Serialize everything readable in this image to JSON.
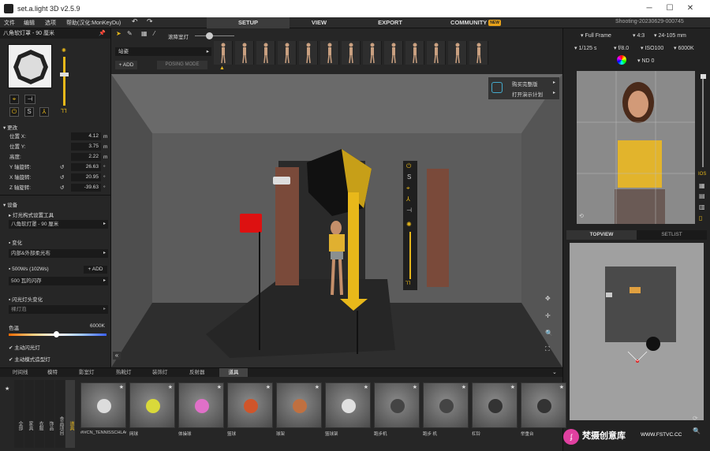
{
  "window": {
    "title": "set.a.light 3D v2.5.9",
    "file_name": "Shooting-20230629-000745"
  },
  "menu": [
    "文件",
    "编辑",
    "选项",
    "帮助(汉化:MonKeyDu)"
  ],
  "tabs": [
    {
      "label": "SETUP",
      "active": true
    },
    {
      "label": "VIEW",
      "active": false
    },
    {
      "label": "EXPORT",
      "active": false
    },
    {
      "label": "COMMUNITY",
      "badge": "NEW",
      "active": false
    }
  ],
  "toolbar": {
    "snap_label": "滚降室灯"
  },
  "left_panel": {
    "title": "八角软灯罩 - 90 厘米",
    "change_section": "更改",
    "fields": [
      {
        "label": "位置 X:",
        "value": "4.12",
        "unit": "m",
        "rotate": false
      },
      {
        "label": "位置 Y:",
        "value": "3.75",
        "unit": "m",
        "rotate": false
      },
      {
        "label": "高度:",
        "value": "2.22",
        "unit": "m",
        "rotate": false
      },
      {
        "label": "Y 轴旋转:",
        "value": "26.63",
        "unit": "°",
        "rotate": true
      },
      {
        "label": "X 轴旋转:",
        "value": "20.95",
        "unit": "°",
        "rotate": true
      },
      {
        "label": "Z 轴旋转:",
        "value": "-39.63",
        "unit": "°",
        "rotate": true
      }
    ],
    "device_section": "设备",
    "shaper_label": "灯光构式设置工具",
    "shaper_value": "八角软灯罩 - 90 厘米",
    "change2_label": "变化",
    "change2_value": "内部&外部柔光布",
    "power_label": "500Ws (102Ws)",
    "add_label": "ADD",
    "flash_value": "500 瓦的闪存",
    "head_label": "闪光灯头变化",
    "head_value": "裸灯泡",
    "color_temp_label": "色温",
    "color_temp_value": "6000K",
    "check1": "主动闪光灯",
    "check2": "主动模式造型灯"
  },
  "pose_bar": {
    "category": "站姿",
    "add_label": "ADD",
    "posing_mode": "POSING MODE"
  },
  "viewport_menu": {
    "item1": "购买完整版",
    "item2": "打开演示计划"
  },
  "camera": {
    "frame": "Full Frame",
    "ratio": "4:3",
    "lens": "24-105 mm",
    "shutter": "1/125 s",
    "aperture": "f/8.0",
    "iso": "ISO100",
    "wb": "6000K",
    "nd": "ND 0",
    "ios_label": "IOS"
  },
  "right_tabs": {
    "topview": "TOPVIEW",
    "setlist": "SETLIST"
  },
  "bottom": {
    "categories": [
      "时间线",
      "模特",
      "影室灯",
      "热靴灯",
      "装饰灯",
      "反射器",
      "道具"
    ],
    "side_tabs": [
      "全部",
      "家具",
      "衣服",
      "饰品",
      "食品项目",
      "道具"
    ],
    "items": [
      {
        "label": "#I#CN_TENNISSCHLAGER_01#I#",
        "color": "#dcdcdc"
      },
      {
        "label": "网球",
        "color": "#d9d93a"
      },
      {
        "label": "体操球",
        "color": "#e070c8"
      },
      {
        "label": "篮球",
        "color": "#d0552a"
      },
      {
        "label": "球架",
        "color": "#c07040"
      },
      {
        "label": "篮球架",
        "color": "#e0e0e0"
      },
      {
        "label": "跑步机",
        "color": "#444444"
      },
      {
        "label": "跑步 机",
        "color": "#444444"
      },
      {
        "label": "杠铃",
        "color": "#333333"
      },
      {
        "label": "举重台",
        "color": "#333333"
      }
    ]
  },
  "watermark": {
    "text": "梵摄创意库",
    "url": "WWW.FSTVC.CC"
  },
  "colors": {
    "accent": "#e8b81a",
    "panel": "#262626",
    "viewport": "#5e5e5e"
  }
}
